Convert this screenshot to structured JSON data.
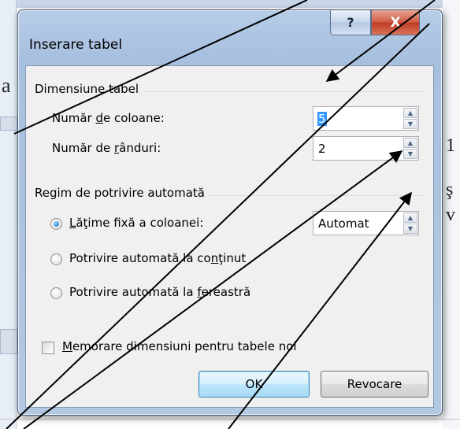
{
  "background": {
    "left_fragment": "a",
    "right_fragments": [
      "1",
      "ş",
      "v"
    ]
  },
  "dialog": {
    "title": "Inserare tabel",
    "help_button": "?",
    "close_button": "X"
  },
  "table_size": {
    "group_label": "Dimensiune tabel",
    "columns": {
      "label_before": "Număr ",
      "label_accel": "d",
      "label_after": "e coloane:",
      "value": "5"
    },
    "rows": {
      "label_before": "Număr de ",
      "label_accel": "r",
      "label_after": "ânduri:",
      "value": "2"
    }
  },
  "autofit": {
    "group_label": "Regim de potrivire automată",
    "fixed_width": {
      "label_accel": "L",
      "label_after": "ăţime fixă a coloanei:",
      "selected": true,
      "value": "Automat"
    },
    "contents": {
      "label_before": "Potrivire automată la co",
      "label_accel": "n",
      "label_after": "ţinut",
      "selected": false
    },
    "window": {
      "label_before": "Potrivire automată la ",
      "label_accel": "f",
      "label_after": "ereastră",
      "selected": false
    }
  },
  "remember": {
    "label_accel": "M",
    "label_after": "emorare dimensiuni pentru tabele noi",
    "checked": false
  },
  "buttons": {
    "ok": "OK",
    "cancel": "Revocare"
  },
  "colors": {
    "titlebar": "#b7cde8",
    "client": "#f0f0f0",
    "selection": "#3399ff",
    "close": "#c7452b"
  },
  "annotation_arrows": 5
}
